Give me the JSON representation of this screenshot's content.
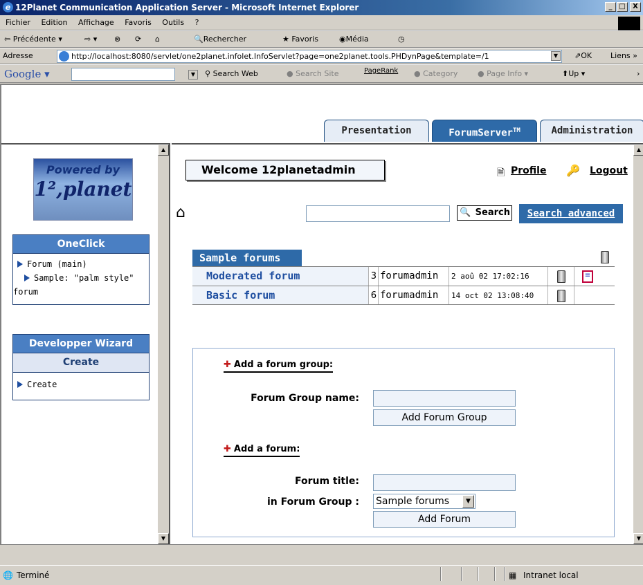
{
  "window": {
    "title": "12Planet Communication Application Server - Microsoft Internet Explorer",
    "min": "_",
    "max": "□",
    "close": "X"
  },
  "menu": [
    "Fichier",
    "Edition",
    "Affichage",
    "Favoris",
    "Outils",
    "?"
  ],
  "toolbar": {
    "back": "Précédente",
    "search": "Rechercher",
    "favorites": "Favoris",
    "media": "Média"
  },
  "address": {
    "label": "Adresse",
    "url": "http://localhost:8080/servlet/one2planet.infolet.InfoServlet?page=one2planet.tools.PHDynPage&template=/1",
    "go": "OK",
    "links": "Liens"
  },
  "google": {
    "logo": "Google",
    "search_web": "Search Web",
    "search_site": "Search Site",
    "pagerank": "PageRank",
    "category": "Category",
    "page_info": "Page Info",
    "up": "Up"
  },
  "tabs": {
    "presentation": "Presentation",
    "forumserver": "ForumServer",
    "forumserver_sup": "TM",
    "administration": "Administration"
  },
  "sidebar": {
    "logo_powered": "Powered by",
    "logo_brand": "1²,planet",
    "oneclick": {
      "title": "OneClick",
      "items": [
        "Forum (main)",
        "Sample: \"palm style\"",
        "forum"
      ]
    },
    "wizard": {
      "title": "Developper Wizard",
      "subtitle": "Create",
      "items": [
        "Create"
      ]
    }
  },
  "main": {
    "welcome": "Welcome 12planetadmin",
    "profile": "Profile",
    "logout": "Logout",
    "search_button": "Search",
    "search_advanced": "Search advanced",
    "forum_group": "Sample forums",
    "forums": [
      {
        "name": "Moderated forum",
        "count": "3",
        "moderator": "forumadmin",
        "date": "2 aoû 02 17:02:16"
      },
      {
        "name": "Basic forum",
        "count": "6",
        "moderator": "forumadmin",
        "date": "14 oct 02 13:08:40"
      }
    ],
    "add_group": {
      "heading": "Add a forum group:",
      "name_label": "Forum Group name:",
      "button": "Add Forum Group"
    },
    "add_forum": {
      "heading": "Add a forum:",
      "title_label": "Forum title:",
      "group_label": "in Forum Group :",
      "group_selected": "Sample forums",
      "button": "Add Forum"
    }
  },
  "status": {
    "text": "Terminé",
    "zone": "Intranet local"
  }
}
